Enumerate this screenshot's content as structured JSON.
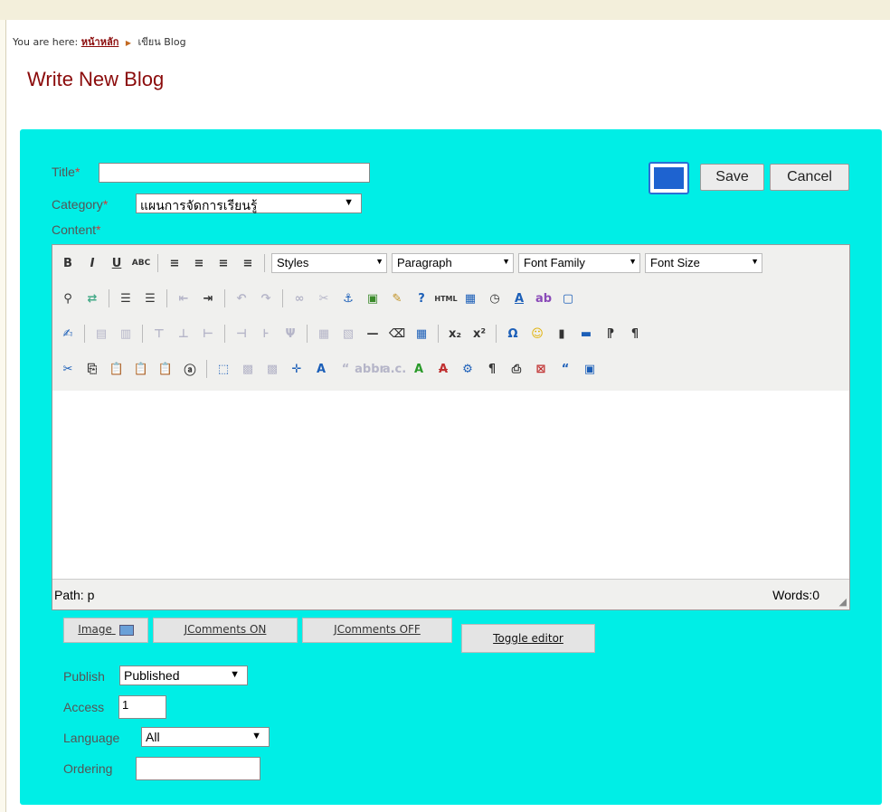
{
  "breadcrumb": {
    "prefix": "You are here:",
    "home": "หน้าหลัก",
    "current": "เขียน Blog"
  },
  "page_title": "Write New Blog",
  "form": {
    "title_label": "Title",
    "title_value": "",
    "category_label": "Category",
    "category_value": "แผนการจัดการเรียนรู้",
    "content_label": "Content",
    "required_mark": "*",
    "save_label": "Save",
    "cancel_label": "Cancel"
  },
  "editor": {
    "styles_label": "Styles",
    "paragraph_label": "Paragraph",
    "font_family_label": "Font Family",
    "font_size_label": "Font Size",
    "path_text": "Path: p",
    "words_text": "Words:0"
  },
  "extra_buttons": {
    "image": "Image",
    "jcomments_on": "JComments ON",
    "jcomments_off": "JComments OFF",
    "toggle_editor": "Toggle editor"
  },
  "options": {
    "publish_label": "Publish",
    "publish_value": "Published",
    "access_label": "Access",
    "access_value": "1",
    "language_label": "Language",
    "language_value": "All",
    "ordering_label": "Ordering",
    "ordering_value": ""
  },
  "colors": {
    "panel": "#00eee6",
    "title": "#8b0b0b",
    "link": "#8b0b0b"
  }
}
